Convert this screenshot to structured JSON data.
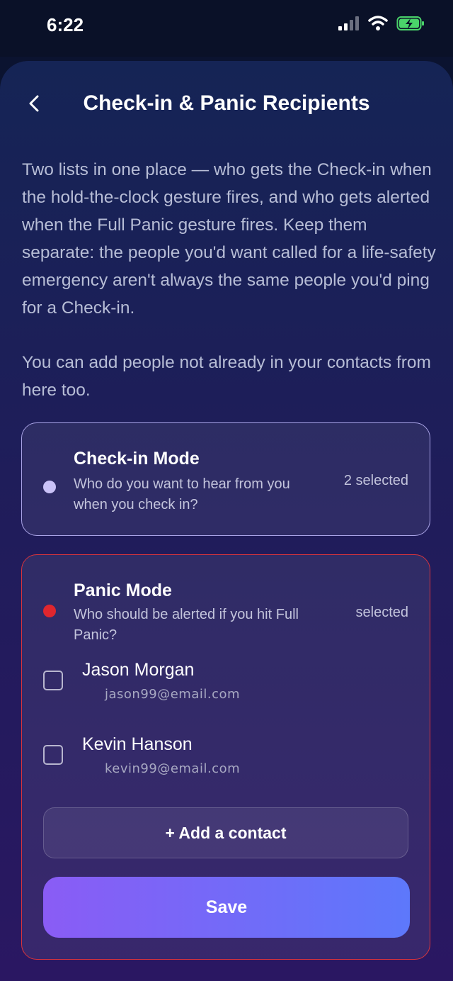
{
  "status_bar": {
    "time": "6:22"
  },
  "header": {
    "title": "Check-in & Panic Recipients"
  },
  "intro": {
    "paragraph1": "Two lists in one place — who gets the Check-in when the hold-the-clock gesture fires, and who gets alerted when the Full Panic gesture fires. Keep them separate: the people you'd want called for a life-safety emergency aren't always the same people you'd ping for a Check-in.",
    "paragraph2": "You can add people not already in your contacts from here too."
  },
  "checkin_mode": {
    "title": "Check-in Mode",
    "description": "Who do you want to hear from you when you check in?",
    "count": "2 selected"
  },
  "panic_mode": {
    "title": "Panic Mode",
    "description": "Who should be alerted if you hit Full Panic?",
    "count": "selected",
    "contacts": [
      {
        "name": "Jason Morgan",
        "email": "jason99@email.com",
        "checked": false
      },
      {
        "name": "Kevin Hanson",
        "email": "kevin99@email.com",
        "checked": false
      }
    ],
    "add_label": "+ Add a contact",
    "save_label": "Save"
  },
  "colors": {
    "checkin_accent": "#c9c2f7",
    "panic_accent": "#e0262e",
    "save_gradient_start": "#8a5cf5",
    "save_gradient_end": "#5d78fb"
  },
  "icons": {
    "back": "chevron-left-icon",
    "signal": "signal-icon",
    "wifi": "wifi-icon",
    "battery": "battery-charging-icon"
  }
}
